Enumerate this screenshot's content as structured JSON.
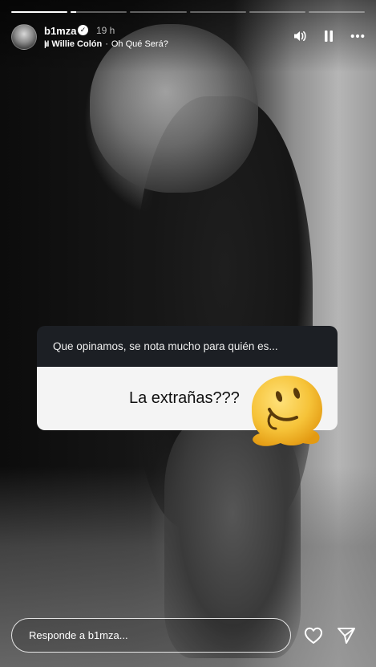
{
  "progress": [
    1,
    0.1,
    0,
    0,
    0,
    0
  ],
  "header": {
    "username": "b1mza",
    "time": "19 h",
    "music": {
      "artist": "Willie Colón",
      "separator": "·",
      "song": "Oh Qué Será?"
    },
    "icons": [
      "volume-icon",
      "pause-icon",
      "more-icon"
    ]
  },
  "question": {
    "prompt": "Que opinamos, se nota mucho para quién es...",
    "answer": "La extrañas???",
    "sticker": "melting-face-emoji"
  },
  "reply": {
    "placeholder": "Responde a b1mza..."
  },
  "actions": [
    "heart-icon",
    "send-icon"
  ],
  "colors": {
    "question_header_bg": "#1c1f24",
    "question_body_bg": "#f4f4f4",
    "emoji_yellow": "#f6c339"
  }
}
